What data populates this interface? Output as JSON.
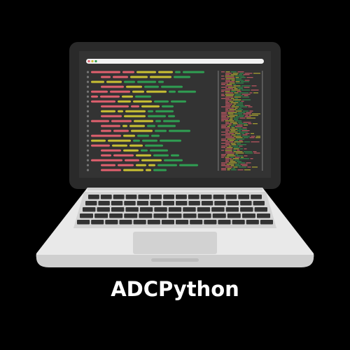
{
  "brand": {
    "name": "ADCPython"
  },
  "colors": {
    "red": "#e0606e",
    "yellow": "#c9c033",
    "green": "#2f9e52",
    "screen": "#333333",
    "bezel": "#2a2a2a"
  },
  "icons": [
    "laptop-illustration",
    "code-editor-illustration"
  ]
}
